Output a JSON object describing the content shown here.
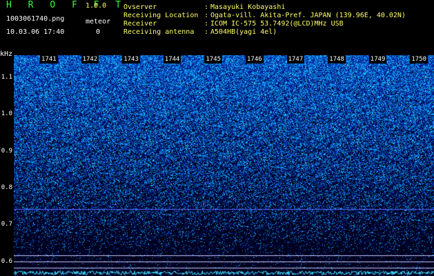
{
  "header": {
    "brand": "H R O F F T",
    "version": "1.0.0",
    "file_name": "1003061740.png",
    "datetime": "10.03.06 17:40",
    "meteor_label": "meteor",
    "meteor_count": "0"
  },
  "info": [
    {
      "label": "Ovserver",
      "value": "Masayuki Kobayashi"
    },
    {
      "label": "Receiving Location",
      "value": "Ogata-vill. Akita-Pref. JAPAN (139.96E, 40.02N)"
    },
    {
      "label": "Receiver",
      "value": "ICOM IC-575 53.7492(@LCD)MHz USB"
    },
    {
      "label": "Receiving antenna",
      "value": "A504HB(yagi 4el)"
    }
  ],
  "info_separator": ":",
  "y_axis": {
    "unit": "kHz",
    "ticks": [
      "1.1",
      "1.0",
      "0.9",
      "0.8",
      "0.7",
      "0.6"
    ]
  },
  "x_axis": {
    "ticks": [
      "1741",
      "1742",
      "1743",
      "1744",
      "1745",
      "1746",
      "1747",
      "1748",
      "1749",
      "1750"
    ]
  },
  "colors": {
    "background": "#000000",
    "spectrum_high": "#1a8cff",
    "spectrum_low": "#000060",
    "carrier_line": "#5a64ff",
    "marker_line": "#c8c8ff",
    "noise_floor": "#40e0ff"
  },
  "chart_data": {
    "type": "heatmap",
    "title": "",
    "xlabel": "",
    "ylabel": "kHz",
    "ylim": [
      0.56,
      1.16
    ],
    "x_ticks": [
      "1741",
      "1742",
      "1743",
      "1744",
      "1745",
      "1746",
      "1747",
      "1748",
      "1749",
      "1750"
    ],
    "y_ticks": [
      1.1,
      1.0,
      0.9,
      0.8,
      0.7,
      0.6
    ],
    "horizontal_lines_khz": [
      0.742,
      0.617,
      0.6,
      0.582
    ]
  }
}
